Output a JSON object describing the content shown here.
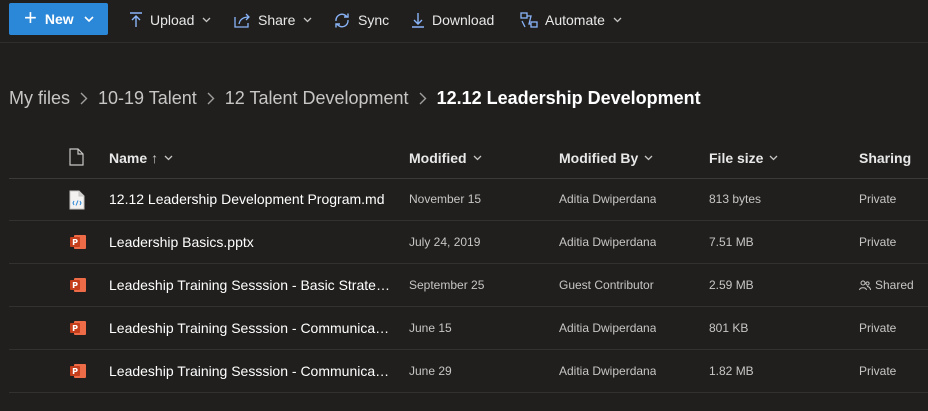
{
  "toolbar": {
    "new_label": "New",
    "upload_label": "Upload",
    "share_label": "Share",
    "sync_label": "Sync",
    "download_label": "Download",
    "automate_label": "Automate"
  },
  "breadcrumb": [
    "My files",
    "10-19 Talent",
    "12 Talent Development",
    "12.12 Leadership Development"
  ],
  "columns": {
    "name": "Name",
    "name_sort_arrow": "↑",
    "modified": "Modified",
    "modified_by": "Modified By",
    "file_size": "File size",
    "sharing": "Sharing"
  },
  "files": [
    {
      "name": "12.12 Leadership Development Program.md",
      "type": "md",
      "modified": "November 15",
      "modified_by": "Aditia Dwiperdana",
      "size": "813 bytes",
      "sharing": "Private"
    },
    {
      "name": "Leadership Basics.pptx",
      "type": "pptx",
      "modified": "July 24, 2019",
      "modified_by": "Aditia Dwiperdana",
      "size": "7.51 MB",
      "sharing": "Private"
    },
    {
      "name": "Leadeship Training Sesssion - Basic Strategic...",
      "type": "pptx",
      "modified": "September 25",
      "modified_by": "Guest Contributor",
      "size": "2.59 MB",
      "sharing": "Shared"
    },
    {
      "name": "Leadeship Training Sesssion - Communicati...",
      "type": "pptx",
      "modified": "June 15",
      "modified_by": "Aditia Dwiperdana",
      "size": "801 KB",
      "sharing": "Private"
    },
    {
      "name": "Leadeship Training Sesssion - Communicati...",
      "type": "pptx",
      "modified": "June 29",
      "modified_by": "Aditia Dwiperdana",
      "size": "1.82 MB",
      "sharing": "Private"
    }
  ],
  "colors": {
    "accent": "#2b88d8",
    "background": "#201f1e",
    "powerpoint": "#c43e1c"
  }
}
